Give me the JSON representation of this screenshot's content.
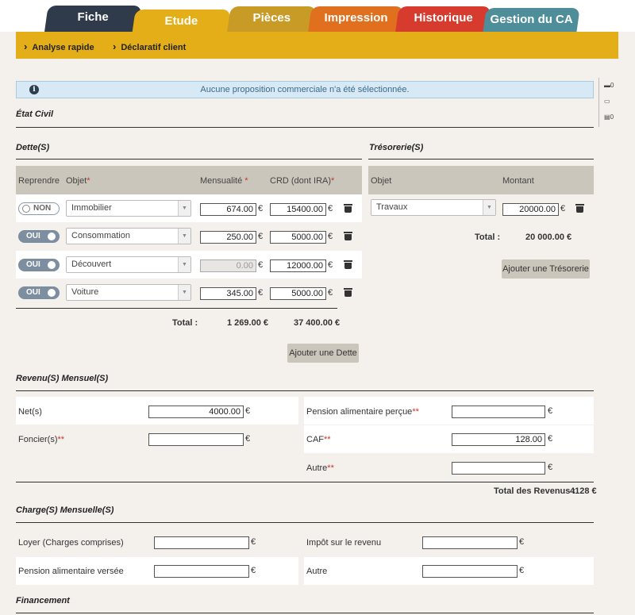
{
  "tabs": [
    {
      "label": "Fiche",
      "color": "#2f3a4a"
    },
    {
      "label": "Etude",
      "color": "#e3ae18"
    },
    {
      "label": "Pièces",
      "color": "#c89a26"
    },
    {
      "label": "Impression",
      "color": "#e06f1e"
    },
    {
      "label": "Historique",
      "color": "#d63b2e"
    },
    {
      "label": "Gestion du CA",
      "color": "#4e8d9a"
    }
  ],
  "subnav": {
    "item1": "Analyse rapide",
    "item2": "Déclaratif client"
  },
  "info_message": "Aucune proposition commerciale n'a été sélectionnée.",
  "side_counts": {
    "c1": "0",
    "c2": "0"
  },
  "sections": {
    "etat_civil": "État Civil",
    "dettes": "Dette(S)",
    "tresorerie": "Trésorerie(S)",
    "revenus": "Revenu(S) Mensuel(S)",
    "charges": "Charge(S) Mensuelle(S)",
    "financement": "Financement"
  },
  "dettes": {
    "headers": {
      "reprendre": "Reprendre",
      "objet": "Objet",
      "mensualite": "Mensualité",
      "crd": "CRD (dont IRA)",
      "req": "*"
    },
    "rows": [
      {
        "toggle": "NON",
        "objet": "Immobilier",
        "mensualite": "674.00",
        "crd": "15400.00"
      },
      {
        "toggle": "OUI",
        "objet": "Consommation",
        "mensualite": "250.00",
        "crd": "5000.00"
      },
      {
        "toggle": "OUI",
        "objet": "Découvert",
        "mensualite": "0.00",
        "crd": "12000.00"
      },
      {
        "toggle": "OUI",
        "objet": "Voiture",
        "mensualite": "345.00",
        "crd": "5000.00"
      }
    ],
    "total_label": "Total :",
    "total_mensualite": "1 269.00 €",
    "total_crd": "37 400.00 €",
    "add_button": "Ajouter une Dette"
  },
  "tresorerie": {
    "headers": {
      "objet": "Objet",
      "montant": "Montant"
    },
    "rows": [
      {
        "objet": "Travaux",
        "montant": "20000.00"
      }
    ],
    "total_label": "Total :",
    "total": "20 000.00 €",
    "add_button": "Ajouter une Trésorerie"
  },
  "euro": "€",
  "revenus": {
    "net": {
      "label": "Net(s)",
      "value": "4000.00"
    },
    "foncier": {
      "label": "Foncier(s)",
      "value": ""
    },
    "pension": {
      "label": "Pension alimentaire perçue",
      "value": ""
    },
    "caf": {
      "label": "CAF",
      "value": "128.00"
    },
    "autre": {
      "label": "Autre",
      "value": ""
    },
    "req2": "**",
    "total_label": "Total des Revenus :",
    "total": "4128 €"
  },
  "charges": {
    "loyer": {
      "label": "Loyer (Charges comprises)",
      "value": ""
    },
    "pension": {
      "label": "Pension alimentaire versée",
      "value": ""
    },
    "impot": {
      "label": "Impôt sur le revenu",
      "value": ""
    },
    "autre": {
      "label": "Autre",
      "value": ""
    }
  }
}
